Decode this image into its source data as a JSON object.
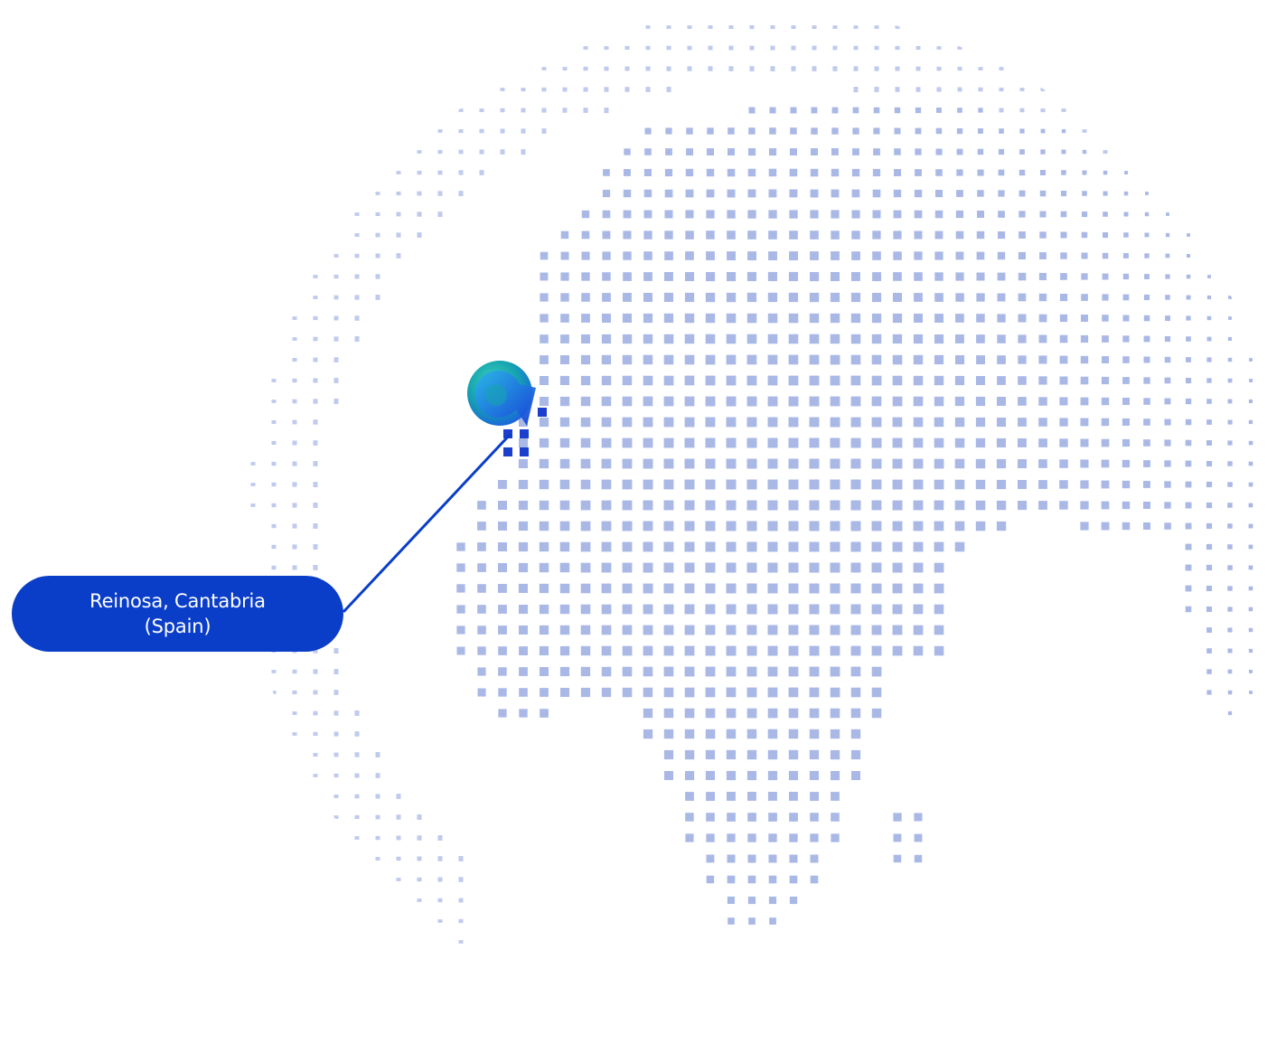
{
  "map": {
    "location_name": "Reinosa, Cantabria",
    "location_country": "(Spain)",
    "logo_icon": "g-arrow-logo-icon"
  },
  "colors": {
    "accent": "#0a3ec8",
    "dots": "#aab8e6",
    "dots_dark": "#1b3fcc",
    "logo_teal": "#12a7a0",
    "logo_blue": "#1e6ee8"
  }
}
